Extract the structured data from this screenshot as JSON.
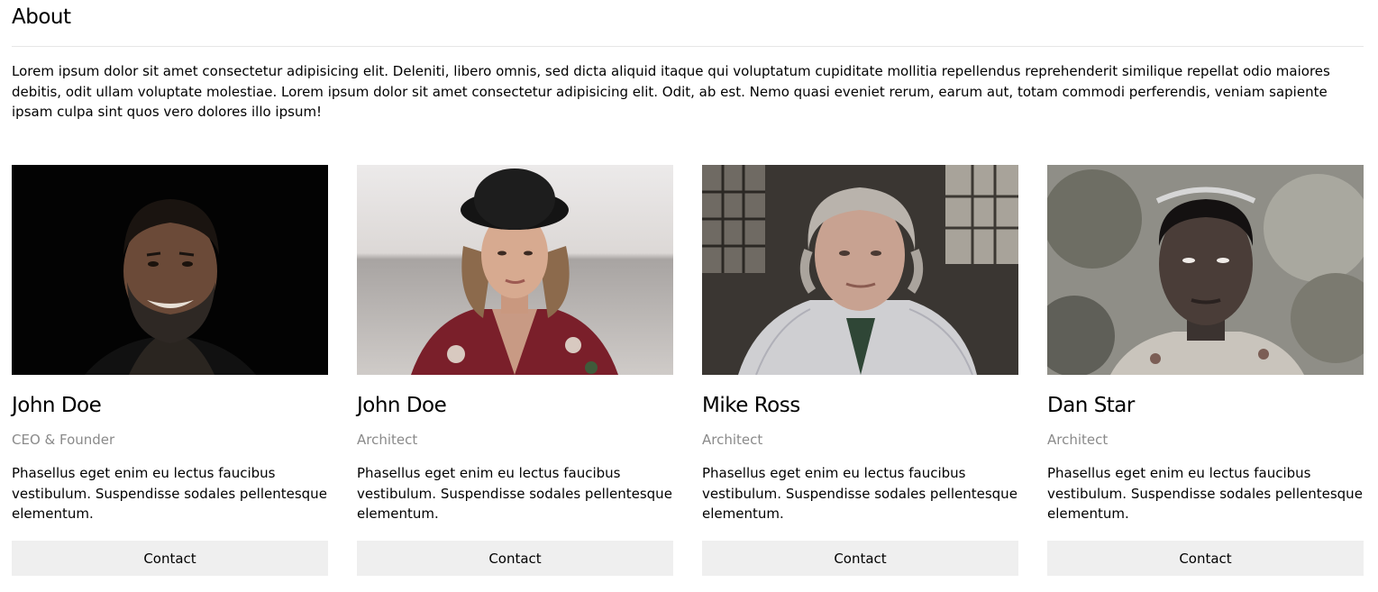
{
  "about": {
    "title": "About",
    "intro": "Lorem ipsum dolor sit amet consectetur adipisicing elit. Deleniti, libero omnis, sed dicta aliquid itaque qui voluptatum cupiditate mollitia repellendus reprehenderit similique repellat odio maiores debitis, odit ullam voluptate molestiae. Lorem ipsum dolor sit amet consectetur adipisicing elit. Odit, ab est. Nemo quasi eveniet rerum, earum aut, totam commodi perferendis, veniam sapiente ipsam culpa sint quos vero dolores illo ipsum!"
  },
  "team": [
    {
      "name": "John Doe",
      "role": "CEO & Founder",
      "bio": "Phasellus eget enim eu lectus faucibus vestibulum. Suspendisse sodales pellentesque elementum.",
      "contact_label": "Contact"
    },
    {
      "name": "John Doe",
      "role": "Architect",
      "bio": "Phasellus eget enim eu lectus faucibus vestibulum. Suspendisse sodales pellentesque elementum.",
      "contact_label": "Contact"
    },
    {
      "name": "Mike Ross",
      "role": "Architect",
      "bio": "Phasellus eget enim eu lectus faucibus vestibulum. Suspendisse sodales pellentesque elementum.",
      "contact_label": "Contact"
    },
    {
      "name": "Dan Star",
      "role": "Architect",
      "bio": "Phasellus eget enim eu lectus faucibus vestibulum. Suspendisse sodales pellentesque elementum.",
      "contact_label": "Contact"
    }
  ],
  "colors": {
    "divider": "#e6e6e6",
    "role_text": "#8a8a8a",
    "button_bg": "#efefef"
  }
}
